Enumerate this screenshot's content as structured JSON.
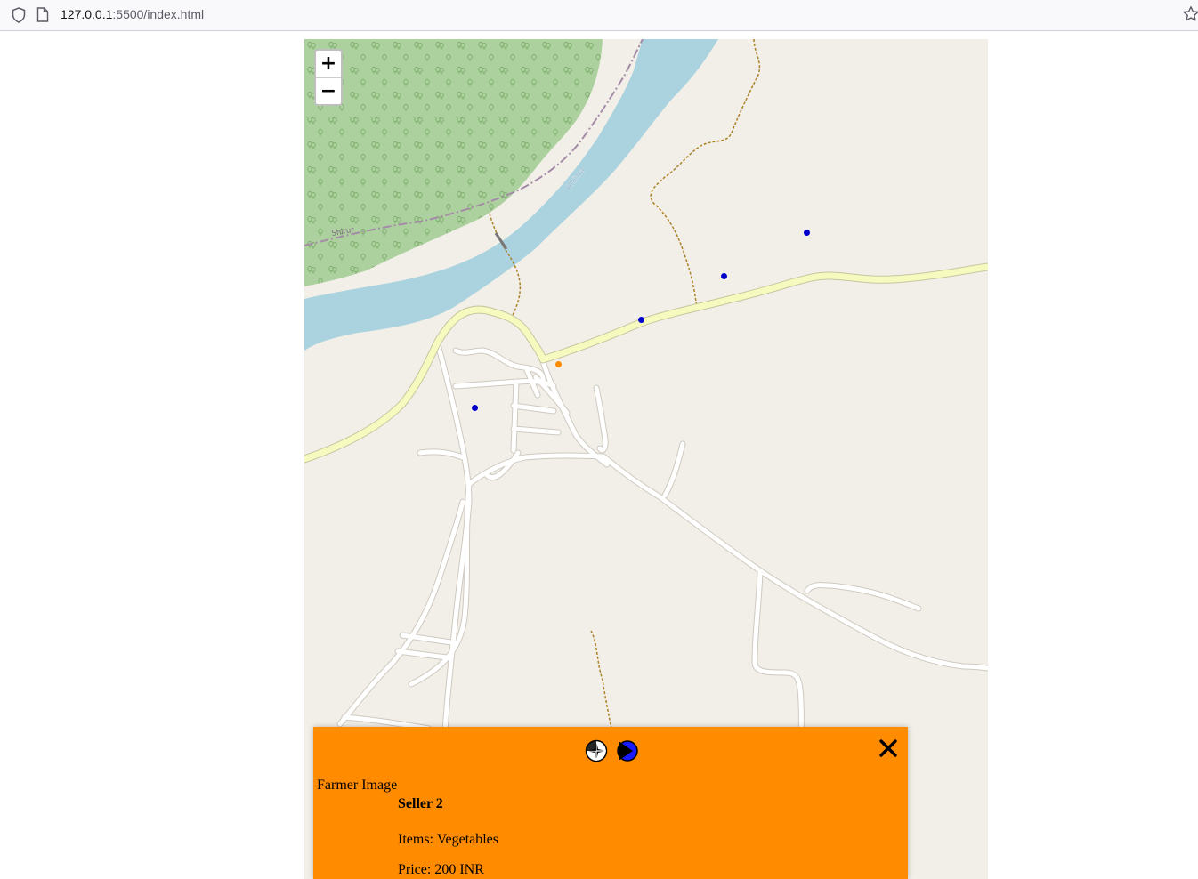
{
  "browser": {
    "url_host": "127.0.0.1",
    "url_rest": ":5500/index.html"
  },
  "map": {
    "zoom_in_label": "+",
    "zoom_out_label": "−",
    "labels": {
      "river": "Bhima",
      "boundary": "Shirur"
    },
    "colors": {
      "land": "#f2efe9",
      "forest": "#add19e",
      "water": "#aad3df",
      "main_road": "#f7fabf",
      "minor_road": "#ffffff",
      "track": "#996600",
      "seller_marker": "#0000cc",
      "user_marker": "#ff8c00"
    },
    "markers": [
      {
        "type": "seller",
        "icon": "seller-marker-icon"
      },
      {
        "type": "seller",
        "icon": "seller-marker-icon"
      },
      {
        "type": "seller",
        "icon": "seller-marker-icon"
      },
      {
        "type": "seller",
        "icon": "seller-marker-icon"
      },
      {
        "type": "user",
        "icon": "user-location-icon"
      }
    ]
  },
  "panel": {
    "background": "#ff8c00",
    "icons": [
      "directions-wheel-icon",
      "next-arrow-icon"
    ],
    "close_icon": "close-icon",
    "image_alt": "Farmer Image",
    "seller_name": "Seller 2",
    "items_label": "Items: ",
    "items_value": "Vegetables",
    "price_label": "Price: ",
    "price_value": "200 INR"
  }
}
